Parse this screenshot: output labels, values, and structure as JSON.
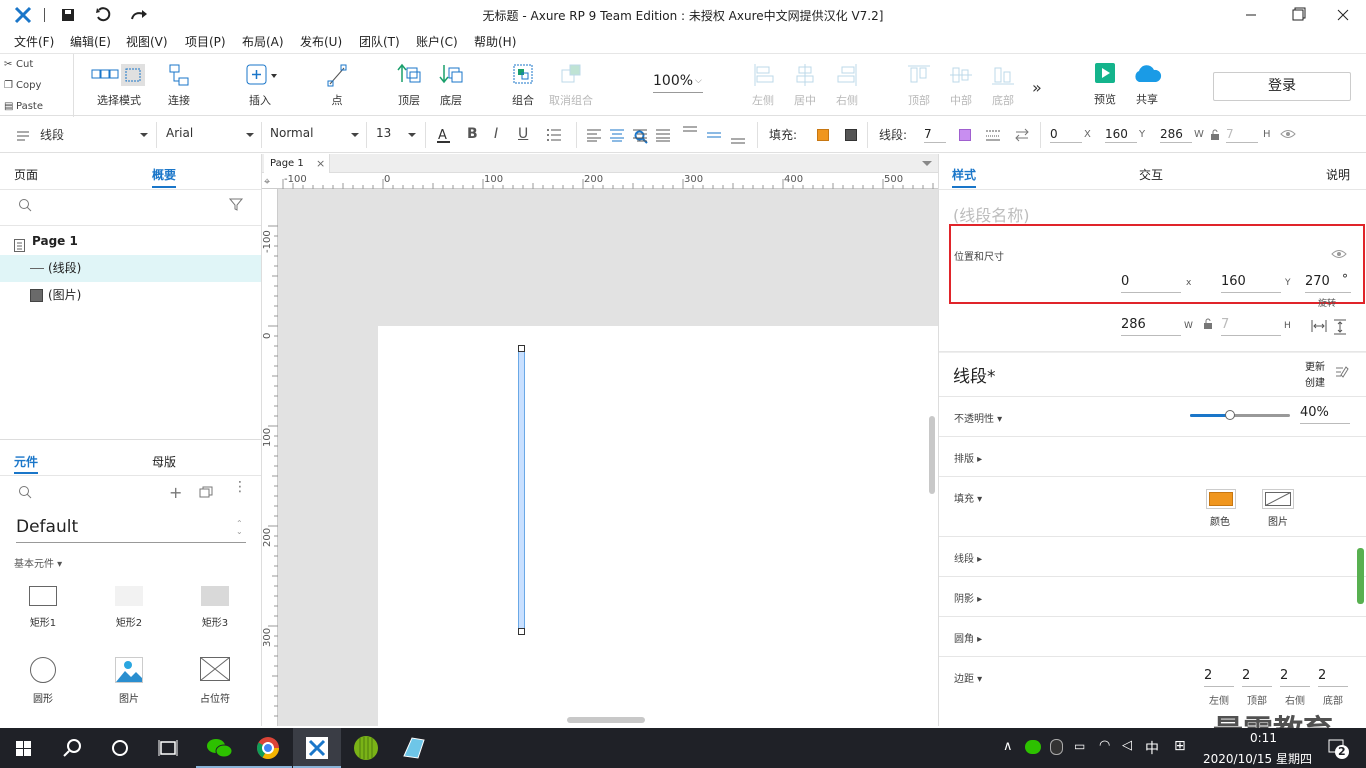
{
  "window": {
    "title": "无标题 - Axure RP 9 Team Edition : 未授权     Axure中文网提供汉化 V7.2]"
  },
  "menu": [
    "文件(F)",
    "编辑(E)",
    "视图(V)",
    "项目(P)",
    "布局(A)",
    "发布(U)",
    "团队(T)",
    "账户(C)",
    "帮助(H)"
  ],
  "clipboard": {
    "cut": "Cut",
    "copy": "Copy",
    "paste": "Paste"
  },
  "toolbar": {
    "select_mode": "选择模式",
    "connect": "连接",
    "insert": "插入",
    "point": "点",
    "top_layer": "顶层",
    "bottom_layer": "底层",
    "group": "组合",
    "ungroup": "取消组合",
    "zoom": "100%",
    "align_left": "左侧",
    "align_center": "居中",
    "align_right": "右侧",
    "align_top": "顶部",
    "align_middle": "中部",
    "align_bottom": "底部",
    "preview": "预览",
    "share": "共享",
    "login": "登录"
  },
  "format": {
    "widget_type": "线段",
    "font": "Arial",
    "style": "Normal",
    "size": "13",
    "fill_label": "填充:",
    "fill_color": "#f0961e",
    "line_label": "线段:",
    "line_width": "7",
    "line_color": "#c88ef0",
    "x": "0",
    "x_label": "X",
    "y": "160",
    "y_label": "Y",
    "w": "286",
    "w_label": "W",
    "h": "7",
    "h_label": "H"
  },
  "left": {
    "tab_pages": "页面",
    "tab_outline": "概要",
    "page": "Page 1",
    "item_line": "(线段)",
    "item_image": "(图片)",
    "tab_widgets": "元件",
    "tab_masters": "母版",
    "library": "Default",
    "category": "基本元件 ▾",
    "widgets": [
      "矩形1",
      "矩形2",
      "矩形3",
      "圆形",
      "图片",
      "占位符"
    ]
  },
  "canvas": {
    "page_tab": "Page 1",
    "ruler_h": [
      "-100",
      "0",
      "100",
      "200",
      "300",
      "400",
      "500"
    ],
    "ruler_v": [
      "-100",
      "0",
      "100",
      "200",
      "300"
    ]
  },
  "right": {
    "tab_style": "样式",
    "tab_interact": "交互",
    "tab_notes": "说明",
    "name_placeholder": "(线段名称)",
    "pos_size_label": "位置和尺寸",
    "x": "0",
    "x_label": "x",
    "y": "160",
    "y_label": "Y",
    "rotation": "270",
    "rotation_unit": "°",
    "rotation_label": "旋转",
    "w": "286",
    "w_label": "W",
    "h": "7",
    "h_label": "H",
    "style_name": "线段*",
    "update": "更新",
    "create": "创建",
    "opacity_label": "不透明性 ▾",
    "opacity": "40%",
    "opacity_value": 0.4,
    "typeset": "排版 ▸",
    "fill": "填充 ▾",
    "fill_color_label": "颜色",
    "fill_image_label": "图片",
    "line": "线段 ▸",
    "shadow": "阴影 ▸",
    "corner": "圆角 ▸",
    "padding": "边距 ▾",
    "padding_values": [
      "2",
      "2",
      "2",
      "2"
    ],
    "padding_labels": [
      "左侧",
      "顶部",
      "右侧",
      "底部"
    ]
  },
  "taskbar": {
    "ime": "中",
    "time": "0:11",
    "date": "2020/10/15 星期四",
    "notifications": "2",
    "watermark": "最需教育"
  }
}
